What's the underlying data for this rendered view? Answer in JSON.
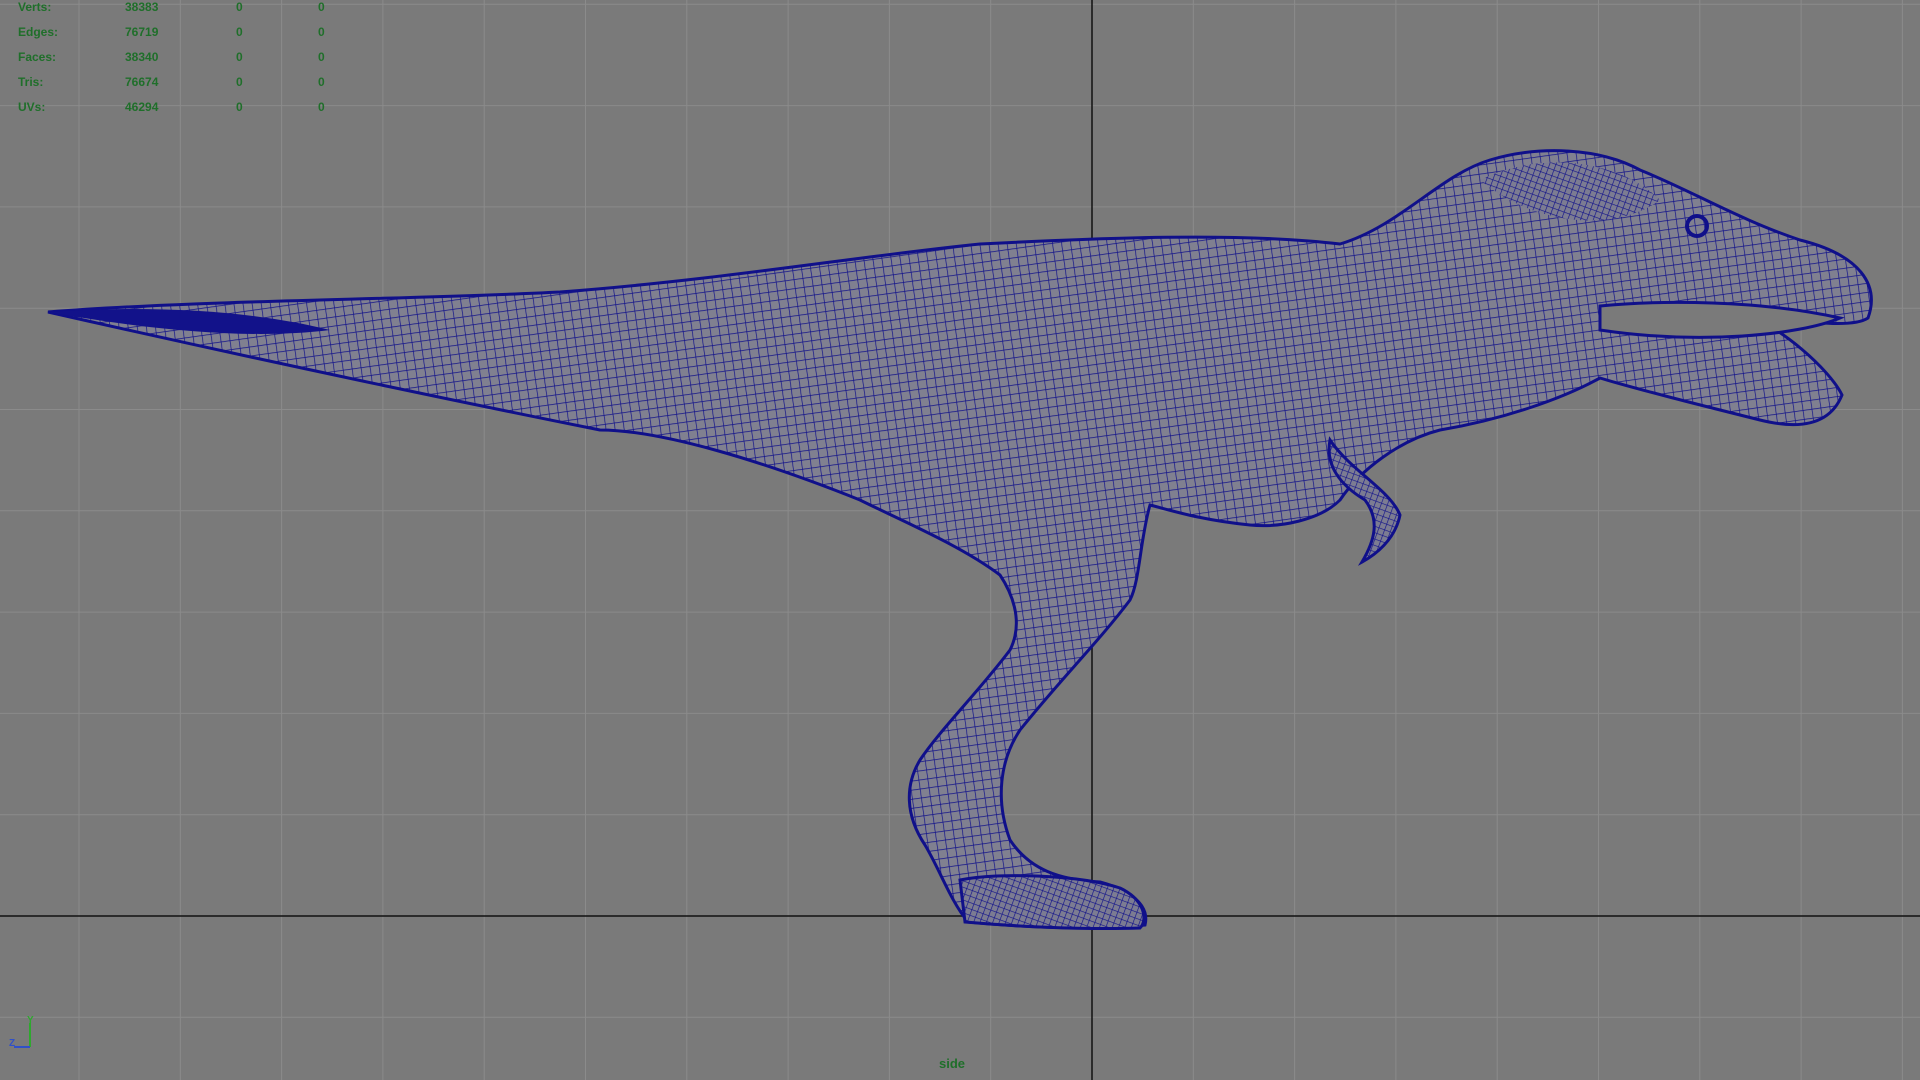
{
  "view": {
    "name": "side",
    "background": "#7a7a7a",
    "wireframe_color": "#10108a",
    "hud_color": "#1f6f2a"
  },
  "poly_count": [
    {
      "label": "Verts:",
      "v1": "38383",
      "v2": "0",
      "v3": "0"
    },
    {
      "label": "Edges:",
      "v1": "76719",
      "v2": "0",
      "v3": "0"
    },
    {
      "label": "Faces:",
      "v1": "38340",
      "v2": "0",
      "v3": "0"
    },
    {
      "label": "Tris:",
      "v1": "76674",
      "v2": "0",
      "v3": "0"
    },
    {
      "label": "UVs:",
      "v1": "46294",
      "v2": "0",
      "v3": "0"
    }
  ],
  "axis": {
    "y": "Y",
    "z": "Z"
  },
  "model": {
    "icon": "trex-wireframe-icon"
  }
}
